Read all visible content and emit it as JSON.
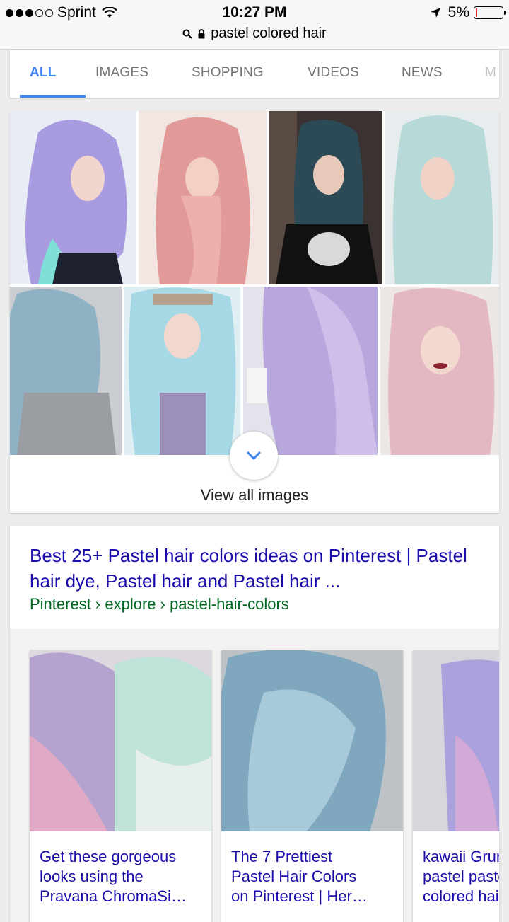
{
  "status_bar": {
    "carrier": "Sprint",
    "time": "10:27 PM",
    "battery": "5%",
    "battery_level": 0.05,
    "url": "pastel colored hair"
  },
  "tabs": [
    "ALL",
    "IMAGES",
    "SHOPPING",
    "VIDEOS",
    "NEWS",
    "M"
  ],
  "active_tab": "ALL",
  "images_section": {
    "view_all_label": "View all images"
  },
  "result": {
    "title": "Best 25+ Pastel hair colors ideas on Pinterest | Pastel hair dye, Pastel hair and Pastel hair ...",
    "url": "Pinterest › explore › pastel-hair-colors"
  },
  "carousel": [
    {
      "text": "Get these gorgeous\nlooks using the\nPravana ChromaSi…"
    },
    {
      "text": "The 7 Prettiest\nPastel Hair Colors\non Pinterest | Her…"
    },
    {
      "text": "kawaii Grun\npastel paste\ncolored hai"
    }
  ],
  "colors": {
    "link_blue": "#1a0dab",
    "url_green": "#006621",
    "tab_active": "#4285f4",
    "tab_inactive": "#757575"
  }
}
